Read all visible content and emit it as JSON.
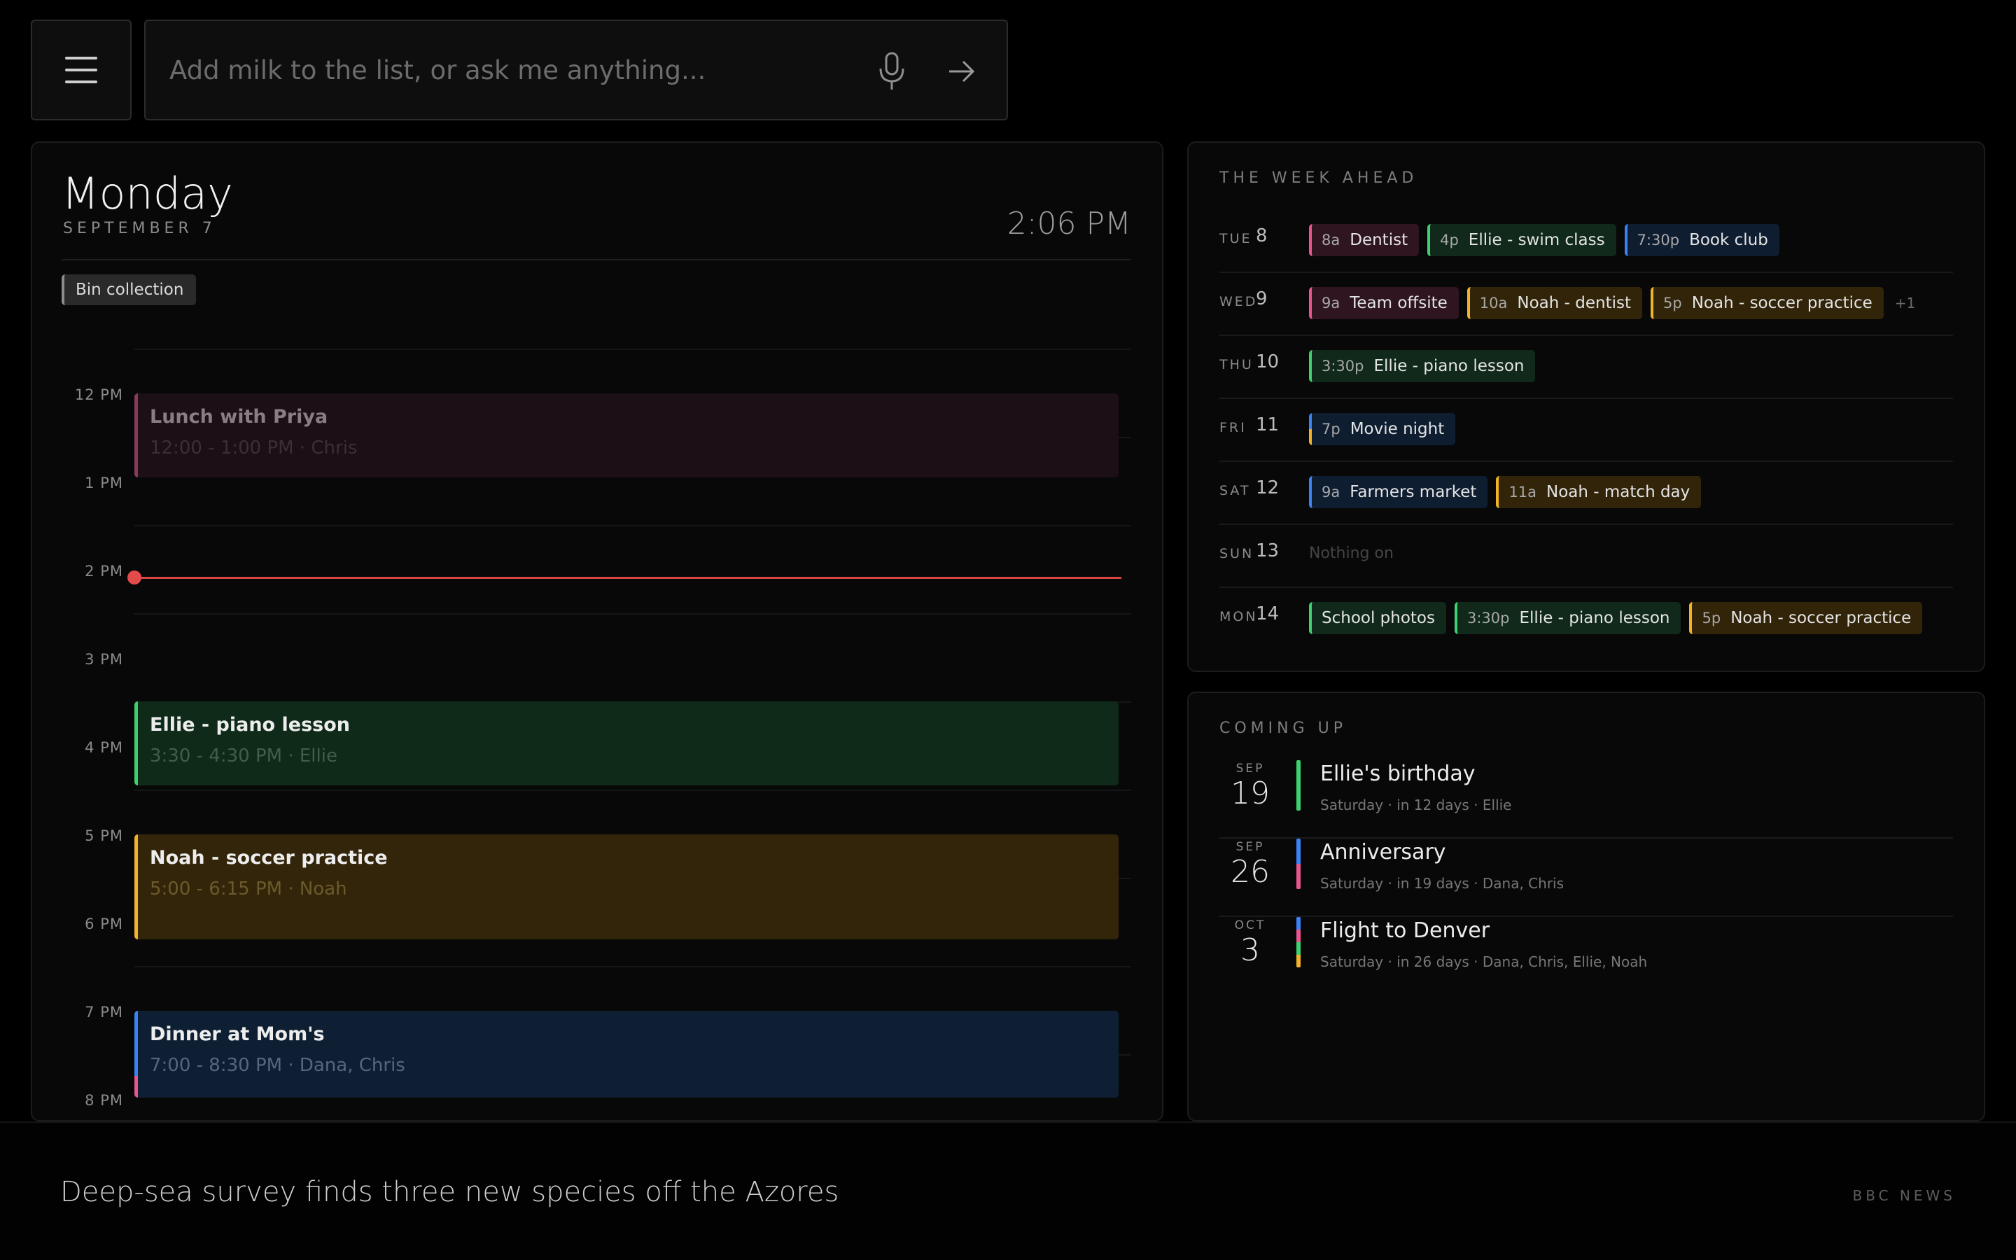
{
  "search": {
    "placeholder": "Add milk to the list, or ask me anything..."
  },
  "today": {
    "day_name": "Monday",
    "date": "SEPTEMBER 7",
    "time": "2:06 PM",
    "all_day": "Bin collection",
    "hours": [
      "12 PM",
      "1 PM",
      "2 PM",
      "3 PM",
      "4 PM",
      "5 PM",
      "6 PM",
      "7 PM",
      "8 PM"
    ],
    "events": [
      {
        "title": "Lunch with Priya",
        "sub": "12:00 - 1:00 PM · Chris",
        "color": "#8a3b5c",
        "bg": "#1c0f16"
      },
      {
        "title": "Ellie - piano lesson",
        "sub": "3:30 - 4:30 PM · Ellie",
        "color": "#3ed16f",
        "bg": "#0f2a18"
      },
      {
        "title": "Noah - soccer practice",
        "sub": "5:00 - 6:15 PM · Noah",
        "color": "#f0b32a",
        "bg": "#332509"
      },
      {
        "title": "Dinner at Mom's",
        "sub": "7:00 - 8:30 PM · Dana, Chris",
        "color": "#3b82f6",
        "color2": "#e8558f",
        "bg": "#0e1f33"
      }
    ]
  },
  "week": {
    "title": "THE WEEK AHEAD",
    "rows": [
      {
        "dow": "TUE",
        "num": "8",
        "chips": [
          {
            "time": "8a",
            "label": "Dentist",
            "color": "#e8558f",
            "bg": "#2e1520"
          },
          {
            "time": "4p",
            "label": "Ellie - swim class",
            "color": "#3ed16f",
            "bg": "#10291a"
          },
          {
            "time": "7:30p",
            "label": "Book club",
            "color": "#3b82f6",
            "bg": "#0f1d31"
          }
        ]
      },
      {
        "dow": "WED",
        "num": "9",
        "more": "+1",
        "chips": [
          {
            "time": "9a",
            "label": "Team offsite",
            "color": "#e8558f",
            "bg": "#2e1520"
          },
          {
            "time": "10a",
            "label": "Noah - dentist",
            "color": "#f0b32a",
            "bg": "#312409"
          },
          {
            "time": "5p",
            "label": "Noah - soccer practice",
            "color": "#f0b32a",
            "bg": "#312409"
          }
        ]
      },
      {
        "dow": "THU",
        "num": "10",
        "chips": [
          {
            "time": "3:30p",
            "label": "Ellie - piano lesson",
            "color": "#3ed16f",
            "bg": "#10291a"
          }
        ]
      },
      {
        "dow": "FRI",
        "num": "11",
        "chips": [
          {
            "time": "7p",
            "label": "Movie night",
            "color": "#3b82f6",
            "color2": "#f0b32a",
            "bg": "#0f1d31"
          }
        ]
      },
      {
        "dow": "SAT",
        "num": "12",
        "chips": [
          {
            "time": "9a",
            "label": "Farmers market",
            "color": "#3b82f6",
            "bg": "#0f1d31"
          },
          {
            "time": "11a",
            "label": "Noah - match day",
            "color": "#f0b32a",
            "bg": "#312409"
          }
        ]
      },
      {
        "dow": "SUN",
        "num": "13",
        "empty": "Nothing on",
        "chips": []
      },
      {
        "dow": "MON",
        "num": "14",
        "chips": [
          {
            "time": "",
            "label": "School photos",
            "color": "#3ed16f",
            "bg": "#10291a"
          },
          {
            "time": "3:30p",
            "label": "Ellie - piano lesson",
            "color": "#3ed16f",
            "bg": "#10291a"
          },
          {
            "time": "5p",
            "label": "Noah - soccer practice",
            "color": "#f0b32a",
            "bg": "#312409"
          }
        ]
      }
    ]
  },
  "coming_up": {
    "title": "COMING UP",
    "items": [
      {
        "month": "SEP",
        "day": "19",
        "title": "Ellie's birthday",
        "sub": "Saturday · in 12 days · Ellie",
        "colors": [
          "#3ed16f"
        ]
      },
      {
        "month": "SEP",
        "day": "26",
        "title": "Anniversary",
        "sub": "Saturday · in 19 days · Dana, Chris",
        "colors": [
          "#3b82f6",
          "#e8558f"
        ]
      },
      {
        "month": "OCT",
        "day": "3",
        "title": "Flight to Denver",
        "sub": "Saturday · in 26 days · Dana, Chris, Ellie, Noah",
        "colors": [
          "#3b82f6",
          "#e8558f",
          "#3ed16f",
          "#f0b32a"
        ]
      }
    ]
  },
  "news": {
    "headline": "Deep-sea survey finds three new species off the Azores",
    "source": "BBC NEWS"
  }
}
